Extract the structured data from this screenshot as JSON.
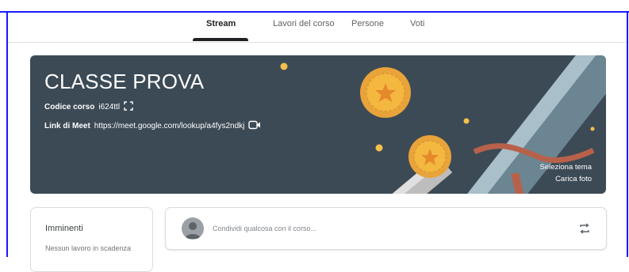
{
  "tabs": {
    "stream": "Stream",
    "classwork": "Lavori del corso",
    "people": "Persone",
    "grades": "Voti"
  },
  "banner": {
    "title": "CLASSE PROVA",
    "code_label": "Codice corso",
    "code_value": "i624ttl",
    "meet_label": "Link di Meet",
    "meet_url": "https://meet.google.com/lookup/a4fys2ndkj",
    "select_theme": "Seleziona tema",
    "upload_photo": "Carica foto"
  },
  "upcoming": {
    "title": "Imminenti",
    "empty": "Nessun lavoro in scadenza"
  },
  "share": {
    "placeholder": "Condividi qualcosa con il corso..."
  },
  "colors": {
    "banner_bg": "#3c4a55",
    "medal_gold": "#f4b740",
    "ribbon": "#b8614a",
    "frame": "#1a1aff"
  },
  "icons": [
    "fullscreen-icon",
    "video-camera-icon",
    "repost-icon",
    "avatar-icon"
  ]
}
